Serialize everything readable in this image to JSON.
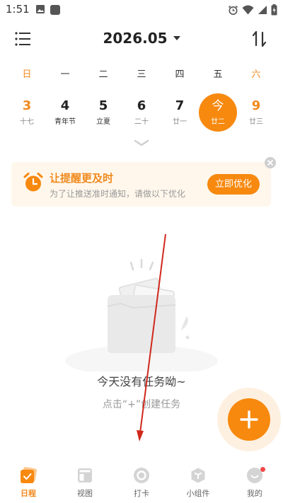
{
  "status_bar": {
    "time": "1:51"
  },
  "header": {
    "month": "2026.05"
  },
  "weekdays": [
    "日",
    "一",
    "二",
    "三",
    "四",
    "五",
    "六"
  ],
  "dates": [
    {
      "num": "3",
      "sub": "十七"
    },
    {
      "num": "4",
      "sub": "青年节"
    },
    {
      "num": "5",
      "sub": "立夏"
    },
    {
      "num": "6",
      "sub": "二十"
    },
    {
      "num": "7",
      "sub": "廿一"
    },
    {
      "num": "今",
      "sub": "廿二"
    },
    {
      "num": "9",
      "sub": "廿三"
    }
  ],
  "banner": {
    "title": "让提醒更及时",
    "subtitle": "为了让推送准时通知，请做以下优化",
    "button": "立即优化"
  },
  "empty_state": {
    "title": "今天没有任务呦~",
    "hint": "点击“+”创建任务"
  },
  "nav": {
    "schedule": "日程",
    "view": "视图",
    "checkin": "打卡",
    "widget": "小组件",
    "mine": "我的"
  },
  "colors": {
    "accent": "#f7890f",
    "weekend": "#f08a1e",
    "annotation_arrow": "#d0281c"
  }
}
